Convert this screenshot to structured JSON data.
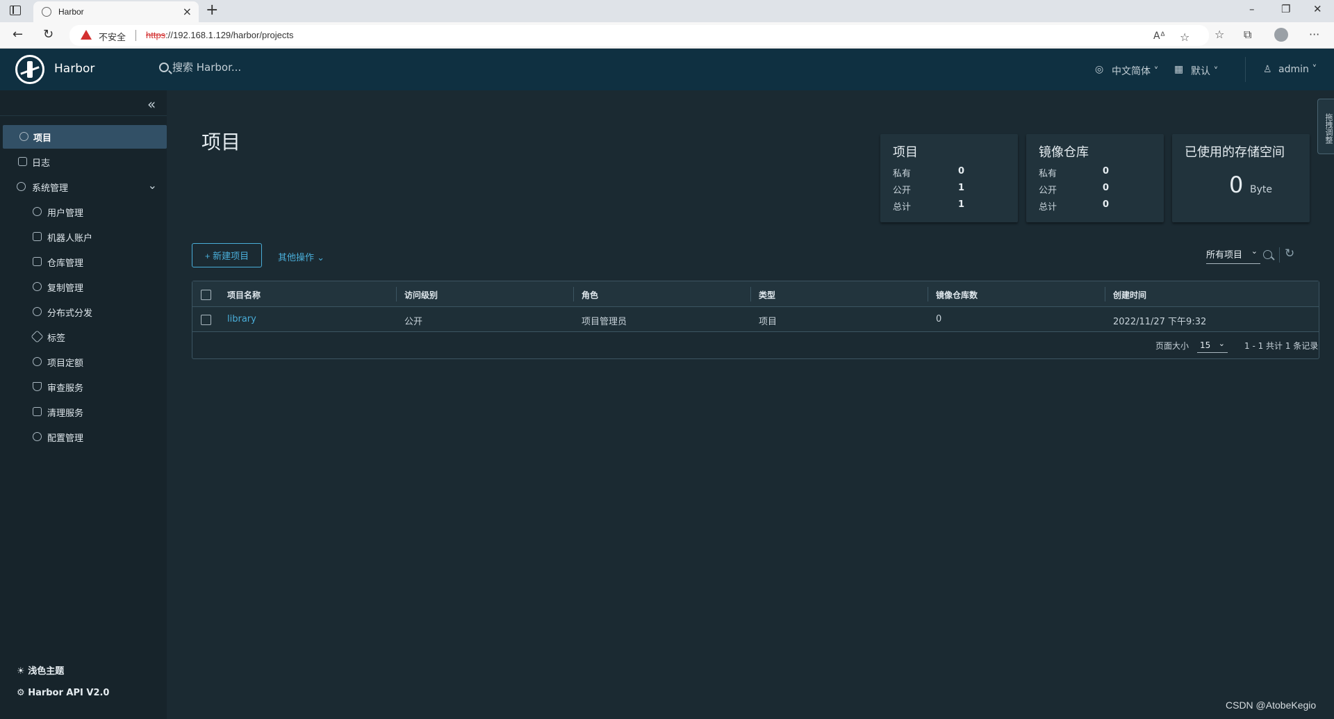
{
  "browser": {
    "tab_title": "Harbor",
    "insecure_label": "不安全",
    "url_scheme": "https",
    "url_rest": "://192.168.1.129/harbor/projects"
  },
  "header": {
    "brand": "Harbor",
    "search_placeholder": "搜索 Harbor...",
    "language": "中文简体",
    "date_format": "默认",
    "user": "admin"
  },
  "sidebar": {
    "items": [
      {
        "label": "项目"
      },
      {
        "label": "日志"
      },
      {
        "label": "系统管理"
      },
      {
        "label": "用户管理"
      },
      {
        "label": "机器人账户"
      },
      {
        "label": "仓库管理"
      },
      {
        "label": "复制管理"
      },
      {
        "label": "分布式分发"
      },
      {
        "label": "标签"
      },
      {
        "label": "项目定额"
      },
      {
        "label": "审查服务"
      },
      {
        "label": "清理服务"
      },
      {
        "label": "配置管理"
      }
    ],
    "theme_label": "浅色主题",
    "api_label": "Harbor API V2.0"
  },
  "main": {
    "title": "项目",
    "cards": {
      "projects": {
        "title": "项目",
        "private_label": "私有",
        "private": "0",
        "public_label": "公开",
        "public": "1",
        "total_label": "总计",
        "total": "1"
      },
      "repos": {
        "title": "镜像仓库",
        "private_label": "私有",
        "private": "0",
        "public_label": "公开",
        "public": "0",
        "total_label": "总计",
        "total": "0"
      },
      "storage": {
        "title": "已使用的存储空间",
        "value": "0",
        "unit": "Byte"
      }
    },
    "new_project_label": "+ 新建项目",
    "other_actions_label": "其他操作",
    "filter_label": "所有项目",
    "table": {
      "headers": [
        "项目名称",
        "访问级别",
        "角色",
        "类型",
        "镜像仓库数",
        "创建时间"
      ],
      "rows": [
        [
          "library",
          "公开",
          "项目管理员",
          "项目",
          "0",
          "2022/11/27 下午9:32"
        ]
      ],
      "page_size_label": "页面大小",
      "page_size": "15",
      "total_text": "1 - 1 共计 1 条记录"
    },
    "side_tab_label": "拖拽调整"
  },
  "watermark": "CSDN @AtobeKegio",
  "colors": {
    "accent": "#4aaed9",
    "header_bg": "#0f3041",
    "sidebar_bg": "#17242b",
    "content_bg": "#1b2a32"
  }
}
